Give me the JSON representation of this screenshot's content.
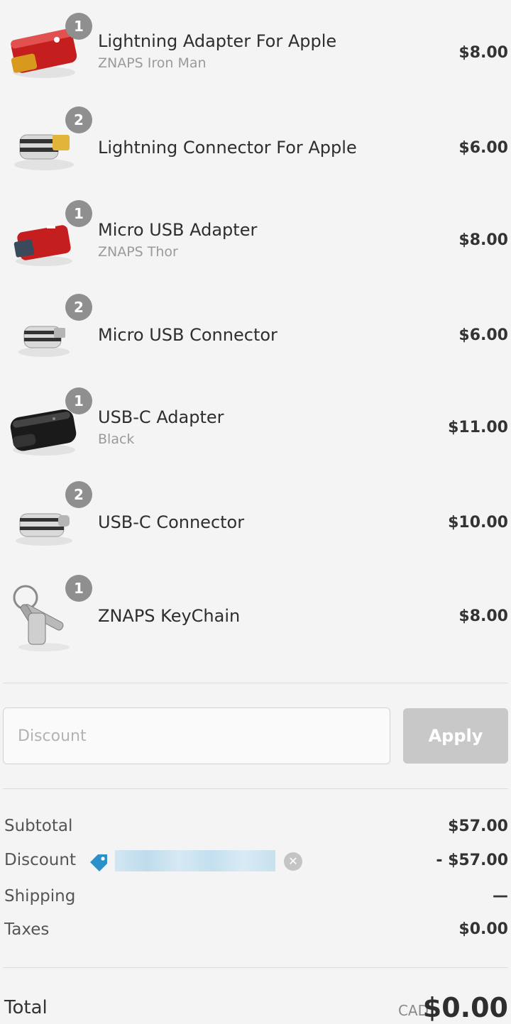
{
  "items": [
    {
      "qty": "1",
      "name": "Lightning Adapter For Apple",
      "variant": "ZNAPS Iron Man",
      "price": "$8.00",
      "image": "red-adapter"
    },
    {
      "qty": "2",
      "name": "Lightning Connector For Apple",
      "variant": "",
      "price": "$6.00",
      "image": "silver-lightning-connector"
    },
    {
      "qty": "1",
      "name": "Micro USB Adapter",
      "variant": "ZNAPS Thor",
      "price": "$8.00",
      "image": "red-usb-adapter"
    },
    {
      "qty": "2",
      "name": "Micro USB Connector",
      "variant": "",
      "price": "$6.00",
      "image": "silver-micro-connector"
    },
    {
      "qty": "1",
      "name": "USB-C Adapter",
      "variant": "Black",
      "price": "$11.00",
      "image": "black-adapter"
    },
    {
      "qty": "2",
      "name": "USB-C Connector",
      "variant": "",
      "price": "$10.00",
      "image": "silver-usbc-connector"
    },
    {
      "qty": "1",
      "name": "ZNAPS KeyChain",
      "variant": "",
      "price": "$8.00",
      "image": "keychain"
    }
  ],
  "discount": {
    "placeholder": "Discount",
    "apply_label": "Apply"
  },
  "summary": {
    "subtotal_label": "Subtotal",
    "subtotal_value": "$57.00",
    "discount_label": "Discount",
    "discount_value": "- $57.00",
    "shipping_label": "Shipping",
    "shipping_value": "—",
    "taxes_label": "Taxes",
    "taxes_value": "$0.00"
  },
  "total": {
    "label": "Total",
    "currency": "CAD",
    "value": "$0.00"
  },
  "colors": {
    "accent": "#2b8fc9",
    "badge": "#8f8f8f",
    "apply_disabled": "#c8c8c8"
  },
  "icons": {
    "tag": "tag-icon",
    "remove": "close-circle-icon"
  }
}
